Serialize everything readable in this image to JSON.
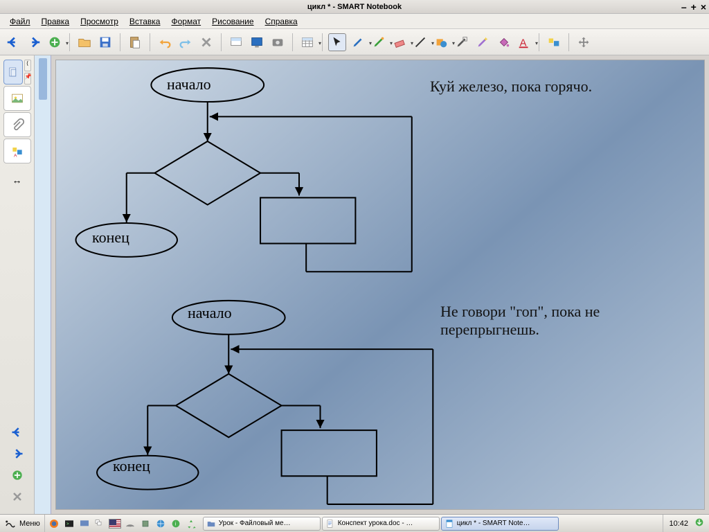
{
  "window": {
    "title": "цикл * - SMART Notebook"
  },
  "menu": {
    "file": "Файл",
    "edit": "Правка",
    "view": "Просмотр",
    "insert": "Вставка",
    "format": "Формат",
    "draw": "Рисование",
    "help": "Справка"
  },
  "canvas": {
    "proverb1": "Куй железо, пока горячо.",
    "proverb2": "Не говори \"гоп\", пока не перепрыгнешь.",
    "flow1": {
      "start": "начало",
      "end": "конец"
    },
    "flow2": {
      "start": "начало",
      "end": "конец"
    }
  },
  "taskbar": {
    "menu": "Меню",
    "task1": "Урок - Файловый ме…",
    "task2": "Конспект урока.doc - …",
    "task3": "цикл * - SMART Note…",
    "clock": "10:42"
  }
}
